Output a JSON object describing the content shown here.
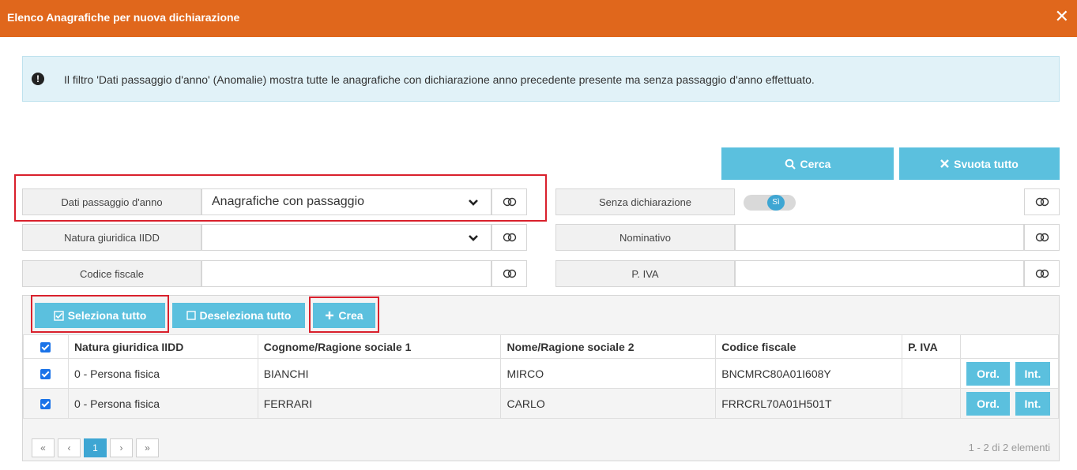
{
  "dialog": {
    "title": "Elenco Anagrafiche per nuova dichiarazione",
    "close_glyph": "✕"
  },
  "info": {
    "icon": "!",
    "text": "Il filtro 'Dati passaggio d'anno' (Anomalie) mostra tutte le anagrafiche con dichiarazione anno precedente presente ma senza passaggio d'anno effettuato."
  },
  "actions": {
    "search_label": "Cerca",
    "clear_label": "Svuota tutto"
  },
  "filters": {
    "dati_passaggio": {
      "label": "Dati passaggio d'anno",
      "value": "Anagrafiche con passaggio"
    },
    "natura_giuridica": {
      "label": "Natura giuridica IIDD",
      "value": ""
    },
    "codice_fiscale": {
      "label": "Codice fiscale",
      "value": ""
    },
    "senza_dichiarazione": {
      "label": "Senza dichiarazione",
      "switch_label": "Sì"
    },
    "nominativo": {
      "label": "Nominativo",
      "value": ""
    },
    "piva": {
      "label": "P. IVA",
      "value": ""
    }
  },
  "toolbar": {
    "select_all": "Seleziona tutto",
    "deselect_all": "Deseleziona tutto",
    "create": "Crea"
  },
  "table": {
    "columns": [
      "Natura giuridica IIDD",
      "Cognome/Ragione sociale 1",
      "Nome/Ragione sociale 2",
      "Codice fiscale",
      "P. IVA"
    ],
    "rows": [
      {
        "natura": "0 - Persona fisica",
        "cognome": "BIANCHI",
        "nome": "MIRCO",
        "cf": "BNCMRC80A01I608Y",
        "piva": ""
      },
      {
        "natura": "0 - Persona fisica",
        "cognome": "FERRARI",
        "nome": "CARLO",
        "cf": "FRRCRL70A01H501T",
        "piva": ""
      }
    ],
    "row_btn_ord": "Ord.",
    "row_btn_int": "Int."
  },
  "pager": {
    "first": "«",
    "prev": "‹",
    "page": "1",
    "next": "›",
    "last": "»",
    "count": "1 - 2 di 2 elementi"
  },
  "colors": {
    "header": "#e0671c",
    "button": "#5bc0de",
    "highlight": "#d9202c"
  }
}
